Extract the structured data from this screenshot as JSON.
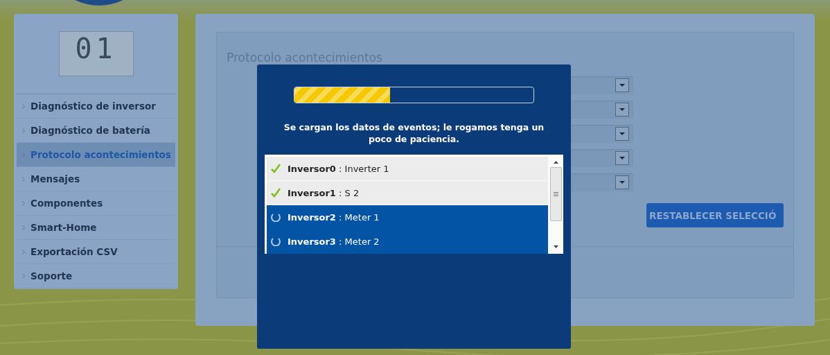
{
  "sidebar": {
    "display": {
      "value": "01"
    },
    "items": [
      {
        "label": "Diagnóstico de inversor",
        "selected": false
      },
      {
        "label": "Diagnóstico de batería",
        "selected": false
      },
      {
        "label": "Protocolo acontecimientos",
        "selected": true
      },
      {
        "label": "Mensajes",
        "selected": false
      },
      {
        "label": "Componentes",
        "selected": false
      },
      {
        "label": "Smart-Home",
        "selected": false
      },
      {
        "label": "Exportación CSV",
        "selected": false
      },
      {
        "label": "Soporte",
        "selected": false
      }
    ]
  },
  "main": {
    "heading": "Protocolo acontecimientos",
    "filters": [
      {
        "kind": "dropdown"
      },
      {
        "kind": "dropdown"
      },
      {
        "kind": "dropdown"
      },
      {
        "kind": "dropdown"
      },
      {
        "kind": "dropdown"
      }
    ],
    "reset_button": "RESTABLECER SELECCIÓ"
  },
  "dialog": {
    "progress": {
      "level": 0.4
    },
    "message": "Se cargan los datos de eventos; le rogamos tenga un poco de paciencia.",
    "devices": [
      {
        "label": "**Inversor0** : Inverter 1",
        "done": true
      },
      {
        "label": "**Inversor1** : S 2",
        "done": true
      },
      {
        "label": "**Inversor2** : Meter 1",
        "done": false
      },
      {
        "label": "**Inversor3** : Meter 2",
        "done": false
      }
    ]
  }
}
